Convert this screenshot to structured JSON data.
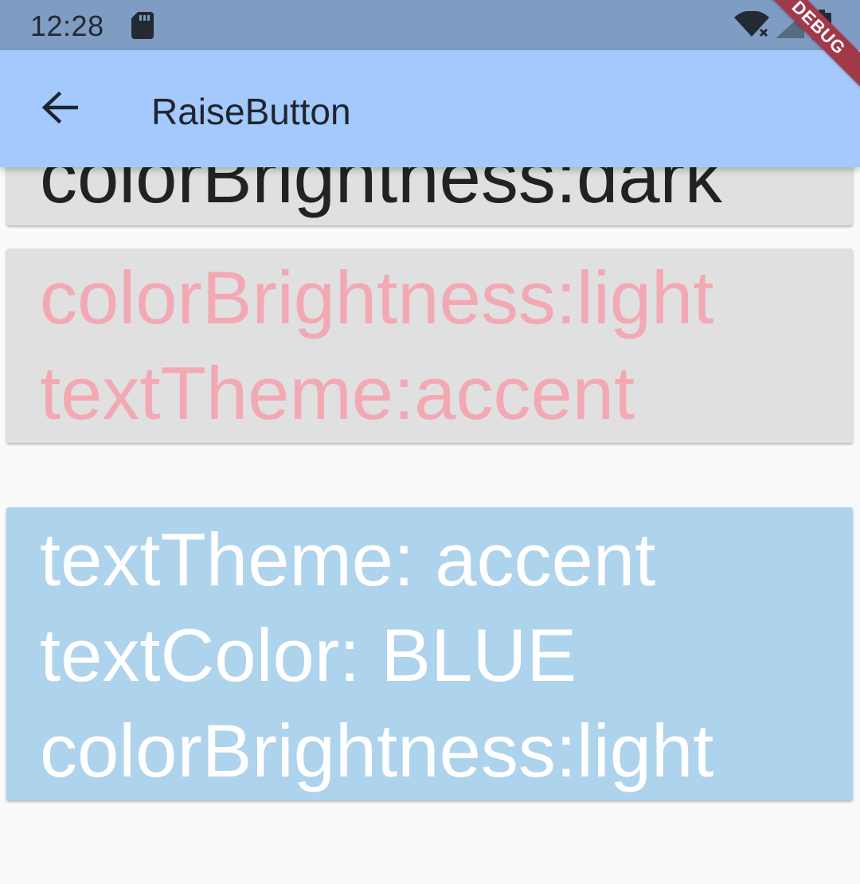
{
  "status_bar": {
    "time": "12:28",
    "icons": [
      "sd-card-icon",
      "wifi-off-icon",
      "signal-icon",
      "battery-charging-icon"
    ],
    "background": "#7f9cc2"
  },
  "debug_banner": {
    "label": "DEBUG",
    "color": "#a2394a"
  },
  "app_bar": {
    "title": "RaiseButton",
    "back_icon": "arrow-back-icon",
    "background": "#a4c9fd"
  },
  "buttons": [
    {
      "label": "colorBrightness:dark",
      "background": "#e0e0e0",
      "text_color": "#222222"
    },
    {
      "label": "colorBrightness:light\ntextTheme:accent",
      "background": "#e0e0e0",
      "text_color": "#f3a9b4"
    },
    {
      "label": "textTheme: accent\ntextColor: BLUE\ncolorBrightness:light",
      "background": "#aed3ec",
      "text_color": "#ffffff"
    }
  ]
}
